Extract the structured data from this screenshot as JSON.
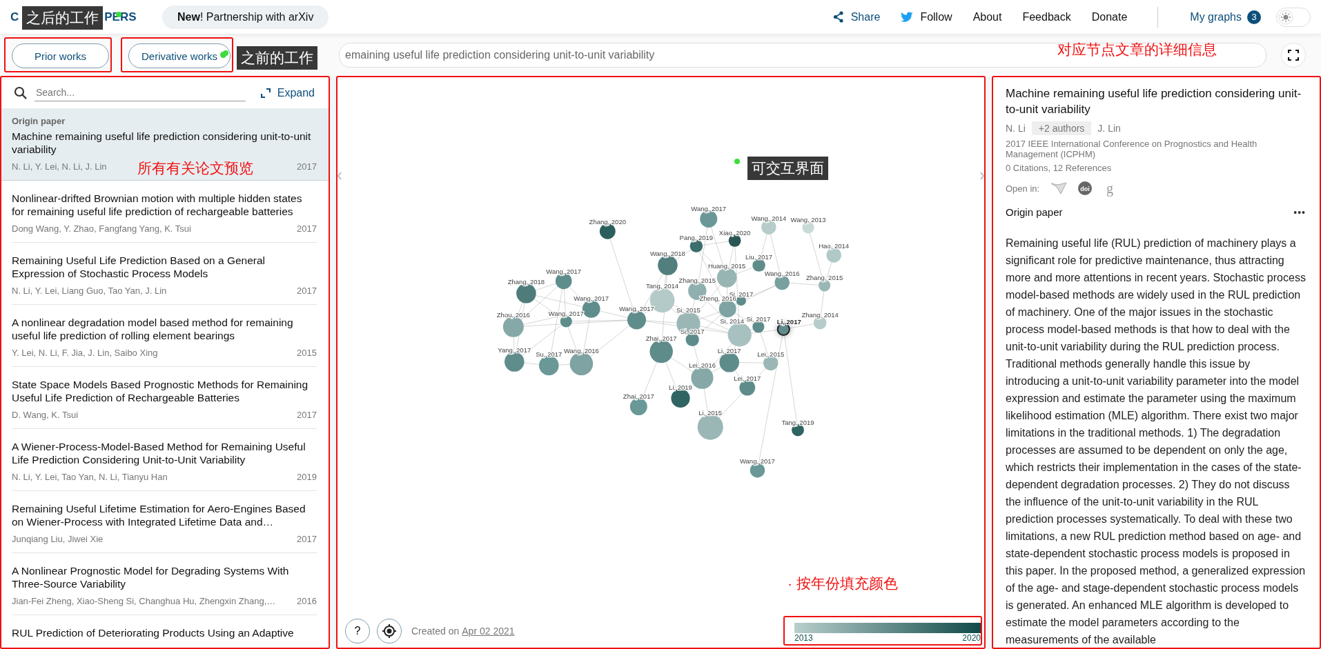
{
  "header": {
    "logo_start": "C",
    "logo_end": "PERS",
    "news": "**New**! Partnership with arXiv",
    "nav": [
      {
        "kind": "share",
        "label": "Share"
      },
      {
        "kind": "follow",
        "label": "Follow"
      },
      {
        "kind": "plain",
        "label": "About"
      },
      {
        "kind": "plain",
        "label": "Feedback"
      },
      {
        "kind": "plain",
        "label": "Donate"
      }
    ],
    "my_graphs": {
      "label": "My graphs",
      "count": "3"
    },
    "dark_mode": false
  },
  "toolbar": {
    "buttons": [
      {
        "label": "Prior works",
        "dot": false
      },
      {
        "label": "Derivative works",
        "dot": true
      }
    ],
    "search_value": "emaining useful life prediction considering unit-to-unit variability"
  },
  "list_panel": {
    "search_placeholder": "Search...",
    "expand_label": "Expand",
    "papers": [
      {
        "tag": "Origin paper",
        "title": "Machine remaining useful life prediction considering unit-to-unit variability",
        "authors": "N. Li, Y. Lei, N. Li, J. Lin",
        "year": "2017",
        "selected": true
      },
      {
        "title": "Nonlinear-drifted Brownian motion with multiple hidden states for remaining useful life prediction of rechargeable batteries",
        "authors": "Dong Wang, Y. Zhao, Fangfang Yang, K. Tsui",
        "year": "2017",
        "selected": false
      },
      {
        "title": "Remaining Useful Life Prediction Based on a General Expression of Stochastic Process Models",
        "authors": "N. Li, Y. Lei, Liang Guo, Tao Yan, J. Lin",
        "year": "2017",
        "selected": false
      },
      {
        "title": "A nonlinear degradation model based method for remaining useful life prediction of rolling element bearings",
        "authors": "Y. Lei, N. Li, F. Jia, J. Lin, Saibo Xing",
        "year": "2015",
        "selected": false
      },
      {
        "title": "State Space Models Based Prognostic Methods for Remaining Useful Life Prediction of Rechargeable Batteries",
        "authors": "D. Wang, K. Tsui",
        "year": "2017",
        "selected": false
      },
      {
        "title": "A Wiener-Process-Model-Based Method for Remaining Useful Life Prediction Considering Unit-to-Unit Variability",
        "authors": "N. Li, Y. Lei, Tao Yan, N. Li, Tianyu Han",
        "year": "2019",
        "selected": false
      },
      {
        "title": "Remaining Useful Lifetime Estimation for Aero-Engines Based on Wiener-Process with Integrated Lifetime Data and…",
        "authors": "Junqiang Liu, Jiwei Xie",
        "year": "2017",
        "selected": false
      },
      {
        "title": "A Nonlinear Prognostic Model for Degrading Systems With Three-Source Variability",
        "authors": "Jian-Fei Zheng, Xiao-Sheng Si, Changhua Hu, Zhengxin Zhang,…",
        "year": "2016",
        "selected": false
      },
      {
        "title": "RUL Prediction of Deteriorating Products Using an Adaptive",
        "selected": false
      }
    ]
  },
  "graph": {
    "nodes": [
      {
        "label": "Wang, 2017",
        "color": "#6a9896",
        "selected": false
      },
      {
        "label": "Zhang, 2020",
        "color": "#2b5f5d",
        "selected": false
      },
      {
        "label": "Wang, 2014",
        "color": "#b5cccb",
        "selected": false
      },
      {
        "label": "Wang, 2013",
        "color": "#c8dad8",
        "selected": false
      },
      {
        "label": "Xiao, 2020",
        "color": "#2a5654",
        "selected": false
      },
      {
        "label": "Pang, 2019",
        "color": "#3b6e6c",
        "selected": false
      },
      {
        "label": "Hao, 2014",
        "color": "#b0c9c8",
        "selected": false
      },
      {
        "label": "Liu, 2017",
        "color": "#5e8c8a",
        "selected": false
      },
      {
        "label": "Wang, 2018",
        "color": "#527f7d",
        "selected": false
      },
      {
        "label": "Huang, 2015",
        "color": "#97b5b3",
        "selected": false
      },
      {
        "label": "Wang, 2016",
        "color": "#77a09f",
        "selected": false
      },
      {
        "label": "Zhang, 2015",
        "color": "#9ab7b6",
        "selected": false
      },
      {
        "label": "Wang, 2017",
        "color": "#5f8d8b",
        "selected": false
      },
      {
        "label": "Zhang, 2018",
        "color": "#4f7c7a",
        "selected": false
      },
      {
        "label": "Zhang, 2015",
        "color": "#8fb0ae",
        "selected": false
      },
      {
        "label": "Tang, 2014",
        "color": "#b3cac9",
        "selected": false
      },
      {
        "label": "Si, 2017",
        "color": "#5e8c8a",
        "selected": false
      },
      {
        "label": "Wang, 2017",
        "color": "#5f8d8b",
        "selected": false
      },
      {
        "label": "Zheng, 2016",
        "color": "#7fa3a2",
        "selected": false
      },
      {
        "label": "Wang, 2017",
        "color": "#5f8d8b",
        "selected": false
      },
      {
        "label": "Zhou, 2016",
        "color": "#86a9a8",
        "selected": false
      },
      {
        "label": "Wang, 2017",
        "color": "#5f8d8b",
        "selected": false
      },
      {
        "label": "Si, 2015",
        "color": "#9ab7b6",
        "selected": false
      },
      {
        "label": "Zhang, 2014",
        "color": "#b5cccb",
        "selected": false
      },
      {
        "label": "Si, 2014",
        "color": "#a7c1c0",
        "selected": false
      },
      {
        "label": "Si, 2017",
        "color": "#5e8c8a",
        "selected": false
      },
      {
        "label": "Li, 2017",
        "color": "#5e8c8a",
        "selected": true
      },
      {
        "label": "Si, 2017",
        "color": "#5e8c8a",
        "selected": false
      },
      {
        "label": "Zhai, 2017",
        "color": "#5e8c8a",
        "selected": false
      },
      {
        "label": "Yang, 2017",
        "color": "#5f8d8b",
        "selected": false
      },
      {
        "label": "Su, 2017",
        "color": "#6a9896",
        "selected": false
      },
      {
        "label": "Wang, 2016",
        "color": "#7fa3a2",
        "selected": false
      },
      {
        "label": "Li, 2017",
        "color": "#5e8c8a",
        "selected": false
      },
      {
        "label": "Lei, 2015",
        "color": "#9ab7b6",
        "selected": false
      },
      {
        "label": "Lei, 2016",
        "color": "#86a9a8",
        "selected": false
      },
      {
        "label": "Lei, 2017",
        "color": "#5e8c8a",
        "selected": false
      },
      {
        "label": "Li, 2019",
        "color": "#2f6462",
        "selected": false
      },
      {
        "label": "Zhai, 2017",
        "color": "#6a9896",
        "selected": false
      },
      {
        "label": "Li, 2015",
        "color": "#9ab7b6",
        "selected": false
      },
      {
        "label": "Tang, 2019",
        "color": "#2f6462",
        "selected": false
      },
      {
        "label": "Wang, 2017",
        "color": "#6a9896",
        "selected": false
      }
    ],
    "help": "?",
    "created_prefix": "Created on",
    "created_date": "Apr 02 2021",
    "legend": {
      "min": "2013",
      "max": "2020"
    }
  },
  "detail": {
    "title": "Machine remaining useful life prediction considering unit-to-unit variability",
    "first_author": "N. Li",
    "more_authors": "+2 authors",
    "last_author": "J. Lin",
    "venue": "2017 IEEE International Conference on Prognostics and Health Management (ICPHM)",
    "counts": "0 Citations, 12 References",
    "open_in": "Open in:",
    "links": [
      {
        "kind": "semantic"
      },
      {
        "kind": "doi",
        "text": "doi"
      },
      {
        "kind": "scholar",
        "text": "g"
      }
    ],
    "section": "Origin paper",
    "more": "•••",
    "abstract": "Remaining useful life (RUL) prediction of machinery plays a significant role for predictive maintenance, thus attracting more and more attentions in recent years. Stochastic process model-based methods are widely used in the RUL prediction of machinery. One of the major issues in the stochastic process model-based methods is that how to deal with the unit-to-unit variability during the RUL prediction process. Traditional methods generally handle this issue by introducing a unit-to-unit variability parameter into the model expression and estimate the parameter using the maximum likelihood estimation (MLE) algorithm. There exist two major limitations in the traditional methods. 1) The degradation processes are assumed to be dependent on only the age, which restricts their implementation in the cases of the state-dependent degradation processes. 2) They do not discuss the influence of the unit-to-unit variability in the RUL prediction processes systematically. To deal with these two limitations, a new RUL prediction method based on age- and state-dependent stochastic process models is proposed in this paper. In the proposed method, a generalized expression of the age- and stage-dependent stochastic process models is generated. An enhanced MLE algorithm is developed to estimate the model parameters according to the measurements of the available"
  },
  "annotations": [
    {
      "kind": "callout",
      "text": "之后的工作"
    },
    {
      "kind": "callout",
      "text": "之前的工作"
    },
    {
      "kind": "note",
      "text": "对应节点文章的详细信息"
    },
    {
      "kind": "note",
      "text": "所有有关论文预览"
    },
    {
      "kind": "callout",
      "text": "可交互界面"
    },
    {
      "kind": "note",
      "text": "· 按年份填充颜色"
    }
  ]
}
